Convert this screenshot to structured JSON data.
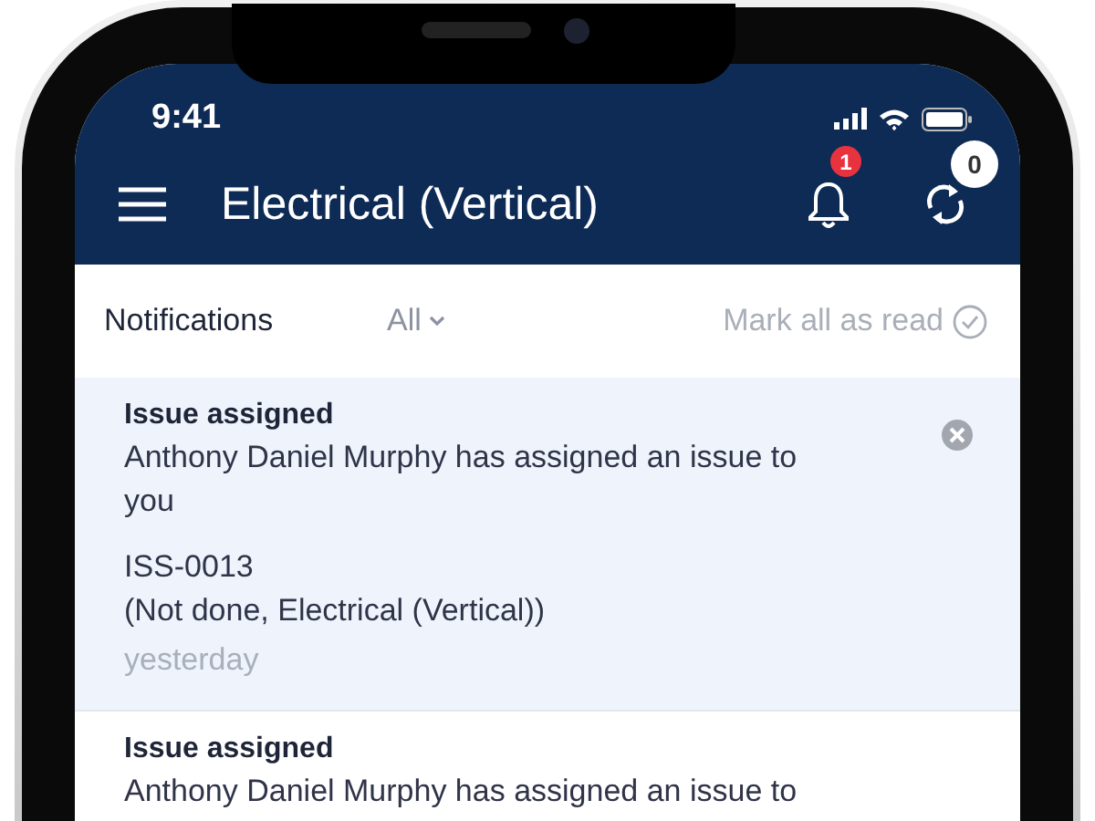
{
  "status_bar": {
    "time": "9:41"
  },
  "app_bar": {
    "title": "Electrical (Vertical)",
    "notification_count": "1",
    "sync_count": "0"
  },
  "toolbar": {
    "title": "Notifications",
    "filter": "All",
    "mark_all": {
      "label": "Mark all as read",
      "disabled": true
    }
  },
  "notifications": [
    {
      "title": "Issue assigned",
      "message": "Anthony Daniel Murphy has assigned an issue to you",
      "issue": "ISS-0013",
      "details": "(Not done, Electrical (Vertical))",
      "time": "yesterday",
      "unread": true
    },
    {
      "title": "Issue assigned",
      "message": "Anthony Daniel Murphy has assigned an issue to",
      "unread": false
    }
  ]
}
